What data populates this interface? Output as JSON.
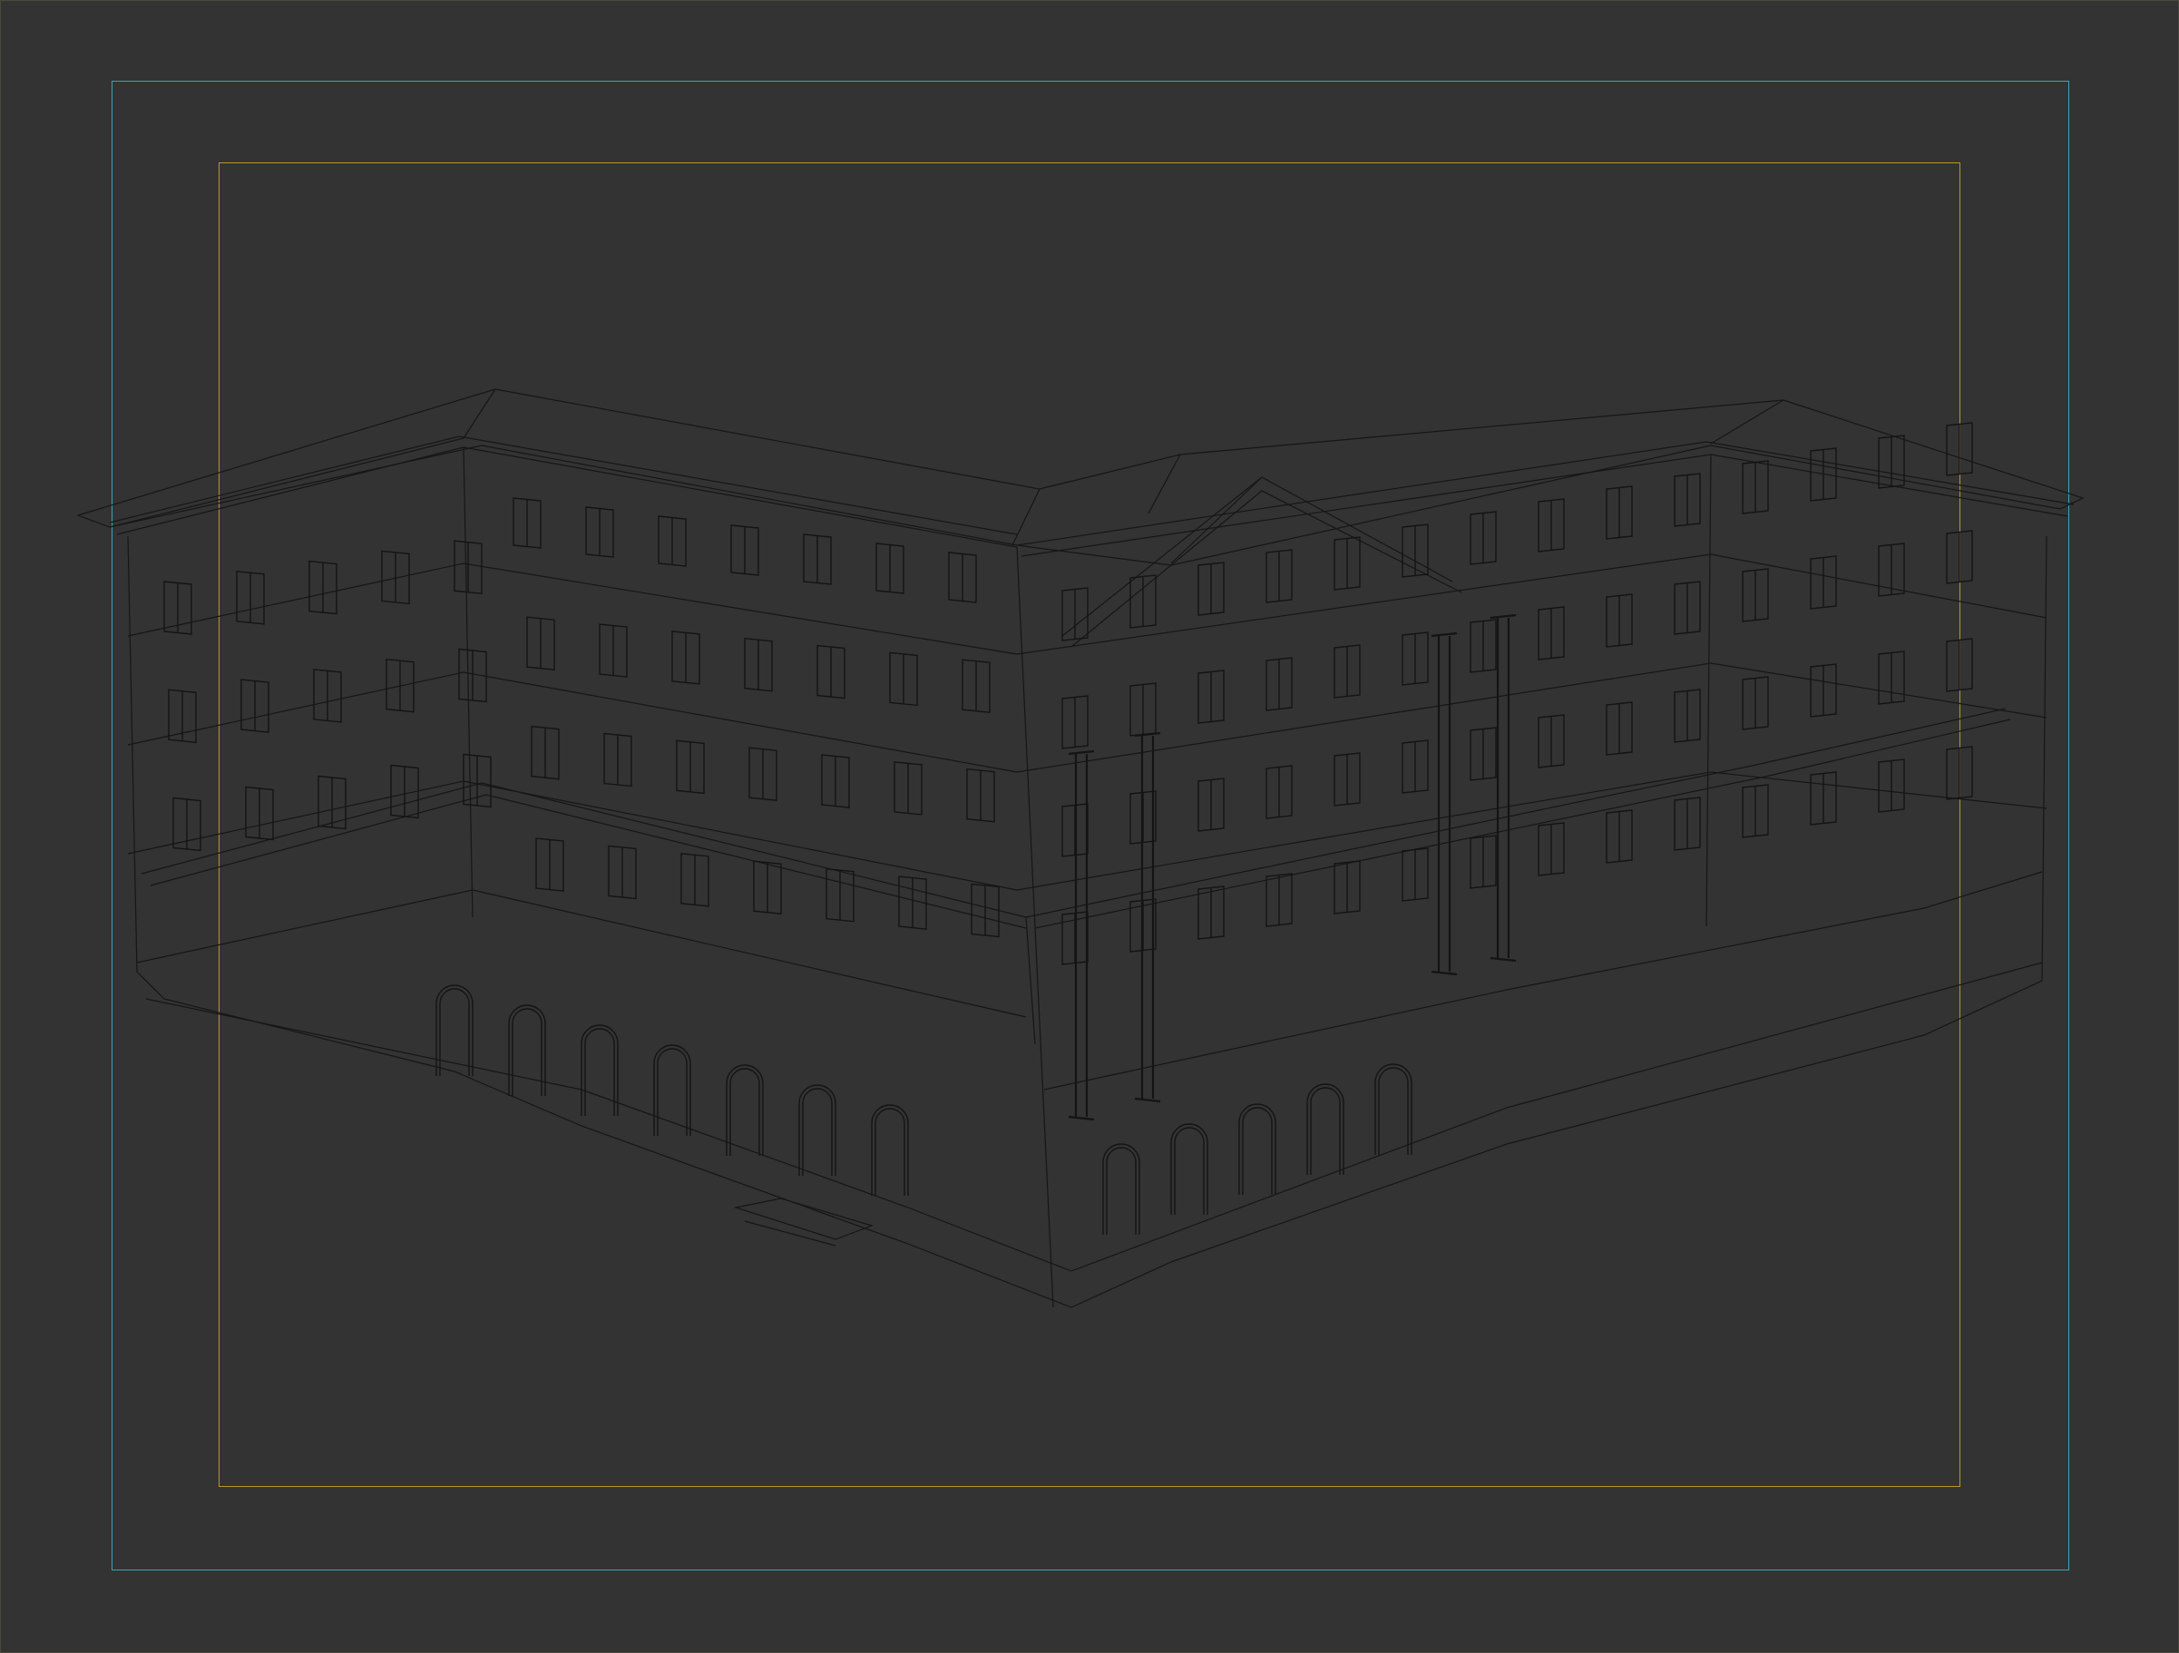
{
  "viewport": {
    "background": "#333333",
    "outer_frame_color": "#35a7b8",
    "inner_frame_color": "#b8962e",
    "wire_color": "#1a1a1a"
  },
  "scene": {
    "object": "building-wireframe",
    "render_mode": "wireframe"
  }
}
